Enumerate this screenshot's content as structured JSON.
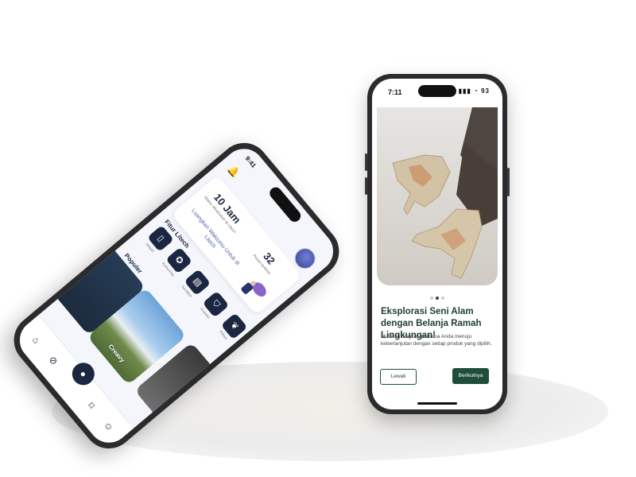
{
  "right_phone": {
    "status": {
      "time": "7:11",
      "icons": "▮▮▮ ◔ 93"
    },
    "onboarding": {
      "title": "Eksplorasi Seni Alam dengan Belanja Ramah Lingkungan!",
      "body": "Mulailah langkah pertama Anda menuju keberlanjutan dengan setiap produk yang dipilih.",
      "skip_label": "Lewati",
      "next_label": "Berikutnya",
      "page_index": 2,
      "page_count": 3
    },
    "colors": {
      "primary": "#1f4d3a"
    }
  },
  "left_phone": {
    "status": {
      "time": "9:41"
    },
    "stats": [
      {
        "value": "10 Jam",
        "label": "Waktu dihabiskan di Litech"
      },
      {
        "value": "32",
        "label": "Pesan terkirim"
      }
    ],
    "tagline": "Luangkan Waktumu Untuk di Litech",
    "features_title": "Fitur Litech",
    "features": [
      {
        "icon": "phone-icon",
        "label": "Jelajah"
      },
      {
        "icon": "award-icon",
        "label": "Komunitas"
      },
      {
        "icon": "document-icon",
        "label": "Sertifikat"
      },
      {
        "icon": "shield-icon",
        "label": "Proteksi"
      },
      {
        "icon": "leaf-icon",
        "label": "Pilihan"
      }
    ],
    "popular_title": "Populer",
    "popular": [
      {
        "name": ""
      },
      {
        "name": "Creavy"
      },
      {
        "name": ""
      }
    ],
    "nav": [
      "home-icon",
      "explore-icon",
      "mic-icon",
      "bookmark-icon",
      "profile-icon"
    ],
    "colors": {
      "primary": "#1b2640"
    }
  }
}
